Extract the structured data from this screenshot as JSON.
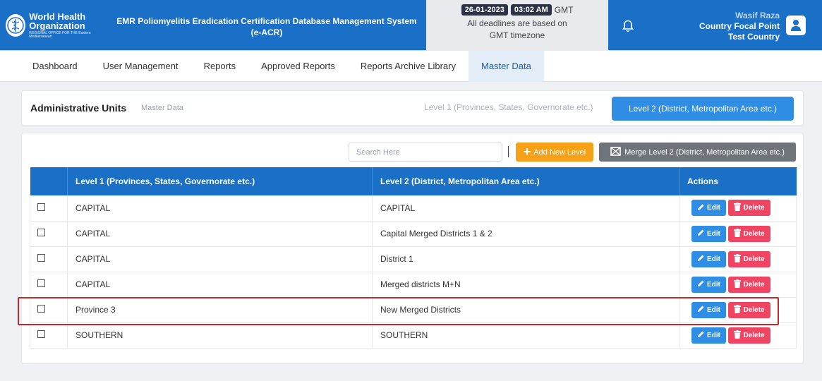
{
  "header": {
    "org_line1": "World Health",
    "org_line2": "Organization",
    "org_region": "REGIONAL OFFICE FOR THE Eastern Mediterranean",
    "system_title": "EMR Poliomyelitis Eradication Certification Database Management System (e-ACR)",
    "date": "26-01-2023",
    "time": "03:02 AM",
    "timezone": "GMT",
    "deadline_note": "All deadlines are based on GMT timezone",
    "user_name": "Wasif Raza",
    "user_role": "Country Focal Point Test Country"
  },
  "nav": {
    "items": [
      {
        "label": "Dashboard"
      },
      {
        "label": "User Management"
      },
      {
        "label": "Reports"
      },
      {
        "label": "Approved Reports"
      },
      {
        "label": "Reports Archive Library"
      },
      {
        "label": "Master Data"
      }
    ],
    "active": "Master Data"
  },
  "page": {
    "title": "Administrative Units",
    "crumb": "Master Data",
    "tab_level1": "Level 1 (Provinces, States, Governorate etc.)",
    "tab_level2": "Level 2 (District, Metropolitan Area etc.)"
  },
  "toolbar": {
    "search_placeholder": "Search Here",
    "separator": "|",
    "add_label": "Add New Level",
    "merge_label": "Merge Level 2 (District, Metropolitan Area etc.)"
  },
  "table": {
    "headers": [
      "",
      "Level 1 (Provinces, States, Governorate etc.)",
      "Level 2 (District, Metropolitan Area etc.)",
      "Actions"
    ],
    "rows": [
      {
        "level1": "CAPITAL",
        "level2": "CAPITAL"
      },
      {
        "level1": "CAPITAL",
        "level2": "Capital Merged Districts 1 & 2"
      },
      {
        "level1": "CAPITAL",
        "level2": "District 1"
      },
      {
        "level1": "CAPITAL",
        "level2": "Merged districts M+N"
      },
      {
        "level1": "Province 3",
        "level2": "New Merged Districts"
      },
      {
        "level1": "SOUTHERN",
        "level2": "SOUTHERN"
      }
    ],
    "edit_label": "Edit",
    "delete_label": "Delete",
    "highlighted_row": 4
  },
  "colors": {
    "primary": "#1a6fc7",
    "accent_blue": "#2f8de4",
    "add_orange": "#f6a11a",
    "merge_gray": "#6f747a",
    "delete_red": "#ef4563",
    "highlight_red": "#c02a2a"
  },
  "icons": {
    "logo": "who-emblem-icon",
    "bell": "bell-icon",
    "avatar": "user-icon",
    "add": "plus-icon",
    "merge": "merge-icon",
    "edit": "pencil-icon",
    "delete": "trash-icon"
  }
}
